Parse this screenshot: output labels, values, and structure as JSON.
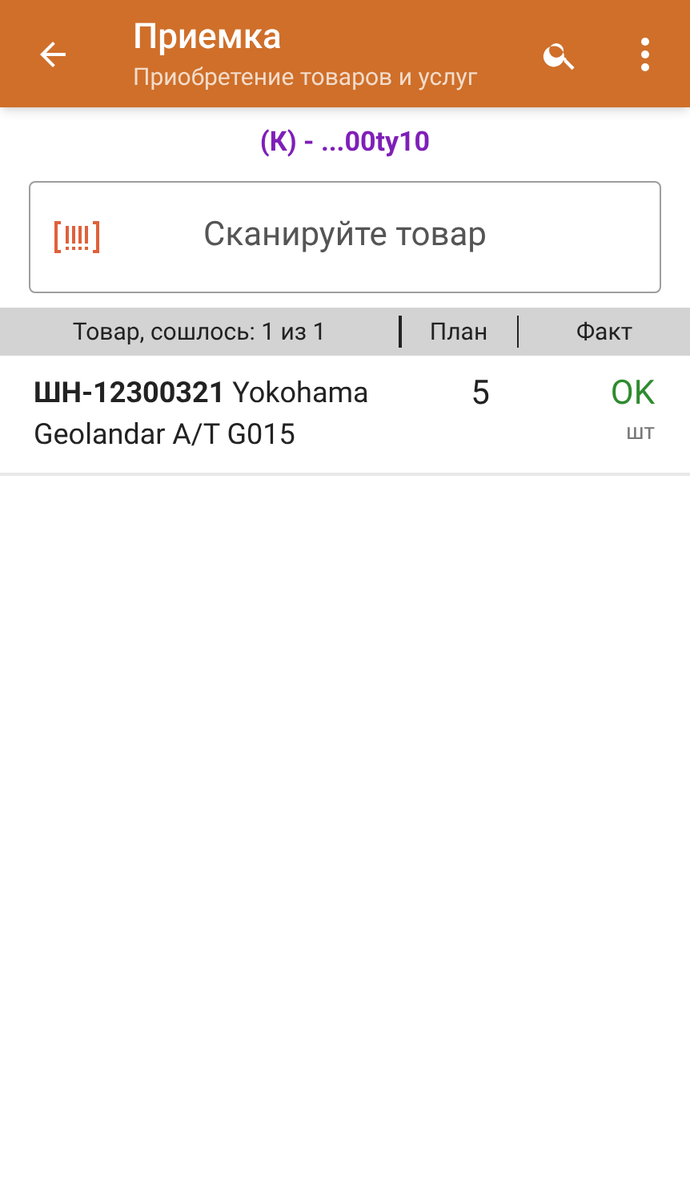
{
  "header": {
    "title": "Приемка",
    "subtitle": "Приобретение товаров и услуг"
  },
  "document": "(К) - ...00ty10",
  "scan_field": {
    "placeholder": "Сканируйте товар"
  },
  "table": {
    "columns": [
      "Товар, сошлось: 1 из 1",
      "План",
      "Факт"
    ],
    "rows": [
      {
        "name": "**ШН-12300321** Yokohama Geolandar A/T G015",
        "plan": "5",
        "fact": "OK",
        "unit": "шт"
      }
    ]
  }
}
